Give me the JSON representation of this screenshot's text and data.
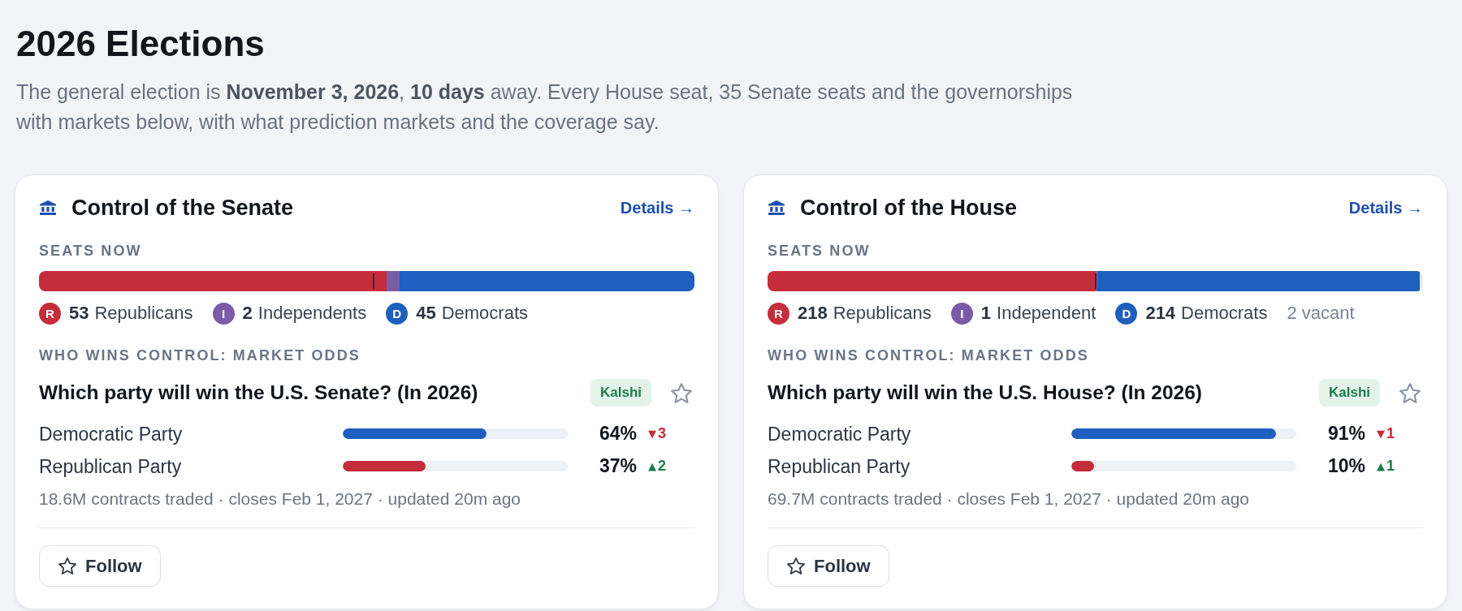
{
  "page": {
    "title": "2026 Elections",
    "description": "The general election is **November 3, 2026**, **10 days** away. Every House seat, 35 Senate seats and the governorships with markets below, with what prediction markets and the coverage say."
  },
  "cards": [
    {
      "title": "Control of the Senate",
      "link": "Details →",
      "seats": {
        "label": "SEATS NOW",
        "bar": {
          "segments": [
            {
              "level": 0.53,
              "color": "#c62d3a"
            },
            {
              "level": 0.02,
              "color": "#7b5ba7"
            },
            {
              "level": 0.45,
              "color": "#1f5fbf"
            }
          ],
          "majority_marker": {
            "level": 0.51
          }
        },
        "parties": [
          {
            "letter": "R",
            "count": "53",
            "name": "Republicans",
            "color": "#c62d3a"
          },
          {
            "letter": "I",
            "count": "2",
            "name": "Independents",
            "color": "#7b5ba7"
          },
          {
            "letter": "D",
            "count": "45",
            "name": "Democrats",
            "color": "#1f5fbf"
          }
        ]
      },
      "market": {
        "label": "WHO WINS CONTROL: MARKET ODDS",
        "question": "Which party will win the U.S. Senate? (In 2026)",
        "source": "Kalshi",
        "outcomes": [
          {
            "name": "Democratic Party",
            "level": 0.64,
            "color": "#1f5fbf",
            "percent": "64%",
            "change": {
              "arrow": "▼",
              "value": "3",
              "color": "#c62d3a"
            }
          },
          {
            "name": "Republican Party",
            "level": 0.37,
            "color": "#c62d3a",
            "percent": "37%",
            "change": {
              "arrow": "▲",
              "value": "2",
              "color": "#1e7c4c"
            }
          }
        ],
        "meta": "18.6M contracts traded · closes Feb 1, 2027 · updated 20m ago"
      },
      "follow_button": "Follow"
    },
    {
      "title": "Control of the House",
      "link": "Details →",
      "seats": {
        "label": "SEATS NOW",
        "bar": {
          "segments": [
            {
              "level": 0.501,
              "color": "#c62d3a"
            },
            {
              "level": 0.0023,
              "color": "#7b5ba7"
            },
            {
              "level": 0.492,
              "color": "#1f5fbf"
            }
          ],
          "majority_marker": {
            "level": 0.501
          }
        },
        "parties": [
          {
            "letter": "R",
            "count": "218",
            "name": "Republicans",
            "color": "#c62d3a"
          },
          {
            "letter": "I",
            "count": "1",
            "name": "Independent",
            "color": "#7b5ba7"
          },
          {
            "letter": "D",
            "count": "214",
            "name": "Democrats",
            "color": "#1f5fbf"
          }
        ],
        "note": "2 vacant"
      },
      "market": {
        "label": "WHO WINS CONTROL: MARKET ODDS",
        "question": "Which party will win the U.S. House? (In 2026)",
        "source": "Kalshi",
        "outcomes": [
          {
            "name": "Democratic Party",
            "level": 0.91,
            "color": "#1f5fbf",
            "percent": "91%",
            "change": {
              "arrow": "▼",
              "value": "1",
              "color": "#c62d3a"
            }
          },
          {
            "name": "Republican Party",
            "level": 0.1,
            "color": "#c62d3a",
            "percent": "10%",
            "change": {
              "arrow": "▲",
              "value": "1",
              "color": "#1e7c4c"
            }
          }
        ],
        "meta": "69.7M contracts traded · closes Feb 1, 2027 · updated 20m ago"
      },
      "follow_button": "Follow"
    }
  ]
}
